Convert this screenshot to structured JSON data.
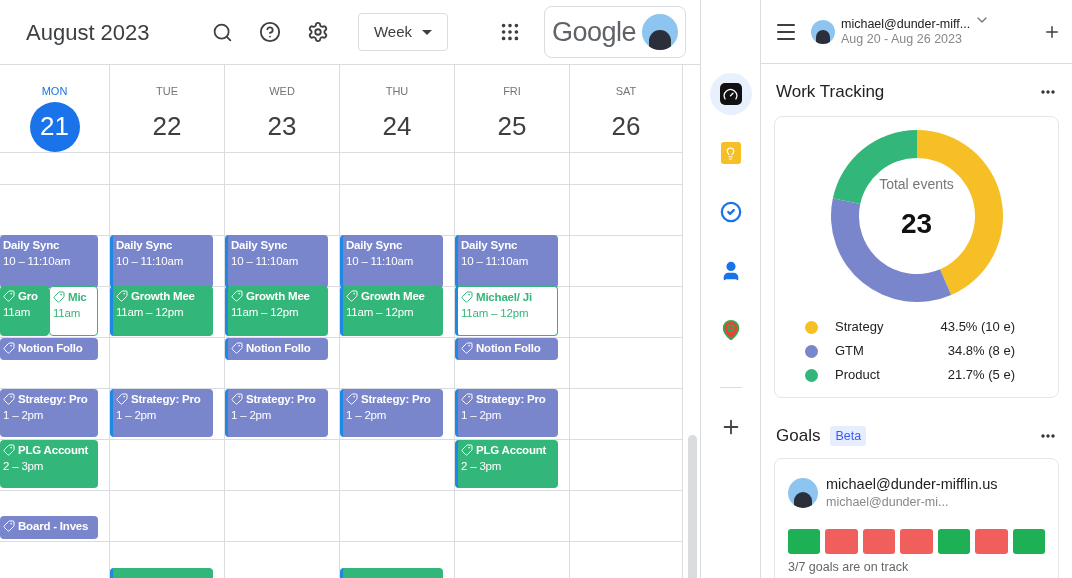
{
  "header": {
    "title": "August 2023",
    "view_select": "Week",
    "account_brand": "Google"
  },
  "days": [
    {
      "name": "MON",
      "number": "21",
      "selected": true,
      "events": [
        {
          "kind": "sync",
          "title": "Daily Sync",
          "time": "10 – 11:10am",
          "color": "#7986cb",
          "outlined": false
        },
        {
          "kind": "meeting",
          "title": "Gro",
          "time": "11am",
          "color": "#33b679",
          "outlined": false
        },
        {
          "kind": "meeting",
          "title": "Mic",
          "time": "11am",
          "color": "#33b679",
          "outlined": true
        },
        {
          "kind": "followup",
          "title": "Notion Follo",
          "color": "#7986cb",
          "outlined": false
        },
        {
          "kind": "strategy",
          "title": "Strategy: Pro",
          "time": "1 – 2pm",
          "color": "#7986cb",
          "outlined": false
        },
        {
          "kind": "plg",
          "title": "PLG Account",
          "time": "2 – 3pm",
          "color": "#33b679",
          "outlined": false
        },
        {
          "kind": "board",
          "title": "Board - Inves",
          "color": "#7986cb",
          "outlined": false
        }
      ]
    },
    {
      "name": "TUE",
      "number": "22",
      "selected": false,
      "events": [
        {
          "kind": "sync",
          "title": "Daily Sync",
          "time": "10 – 11:10am",
          "color": "#7986cb",
          "outlined": false
        },
        {
          "kind": "meeting",
          "title": "Growth Mee",
          "time": "11am – 12pm",
          "color": "#33b679",
          "outlined": false
        },
        {
          "kind": "strategy",
          "title": "Strategy: Pro",
          "time": "1 – 2pm",
          "color": "#7986cb",
          "outlined": false
        },
        {
          "kind": "internal",
          "color": "#33b679",
          "outlined": false
        }
      ]
    },
    {
      "name": "WED",
      "number": "23",
      "selected": false,
      "events": [
        {
          "kind": "sync",
          "title": "Daily Sync",
          "time": "10 – 11:10am",
          "color": "#7986cb",
          "outlined": false
        },
        {
          "kind": "meeting",
          "title": "Growth Mee",
          "time": "11am – 12pm",
          "color": "#33b679",
          "outlined": false
        },
        {
          "kind": "followup",
          "title": "Notion Follo",
          "color": "#7986cb",
          "outlined": false
        },
        {
          "kind": "strategy",
          "title": "Strategy: Pro",
          "time": "1 – 2pm",
          "color": "#7986cb",
          "outlined": false
        }
      ]
    },
    {
      "name": "THU",
      "number": "24",
      "selected": false,
      "events": [
        {
          "kind": "sync",
          "title": "Daily Sync",
          "time": "10 – 11:10am",
          "color": "#7986cb",
          "outlined": false
        },
        {
          "kind": "meeting",
          "title": "Growth Mee",
          "time": "11am – 12pm",
          "color": "#33b679",
          "outlined": false
        },
        {
          "kind": "strategy",
          "title": "Strategy: Pro",
          "time": "1 – 2pm",
          "color": "#7986cb",
          "outlined": false
        },
        {
          "kind": "internal",
          "color": "#33b679",
          "outlined": false
        }
      ]
    },
    {
      "name": "FRI",
      "number": "25",
      "selected": false,
      "events": [
        {
          "kind": "sync",
          "title": "Daily Sync",
          "time": "10 – 11:10am",
          "color": "#7986cb",
          "outlined": false
        },
        {
          "kind": "meeting",
          "title": "Michael/ Ji",
          "time": "11am – 12pm",
          "color": "#33b679",
          "outlined": true
        },
        {
          "kind": "followup",
          "title": "Notion Follo",
          "color": "#7986cb",
          "outlined": false
        },
        {
          "kind": "strategy",
          "title": "Strategy: Pro",
          "time": "1 – 2pm",
          "color": "#7986cb",
          "outlined": false
        },
        {
          "kind": "plg",
          "title": "PLG Account",
          "time": "2 – 3pm",
          "color": "#33b679",
          "outlined": false
        }
      ]
    },
    {
      "name": "SAT",
      "number": "26",
      "selected": false
    }
  ],
  "rail": [
    {
      "kind": "gauge",
      "selected": true
    },
    {
      "kind": "keep",
      "selected": false
    },
    {
      "kind": "tasks",
      "selected": false
    },
    {
      "kind": "contacts",
      "selected": false
    },
    {
      "kind": "maps",
      "selected": false
    },
    {
      "kind": "add",
      "selected": false
    }
  ],
  "panel": {
    "account": "michael@dunder-miff...",
    "date_range": "Aug 20 - Aug 26 2023",
    "work_tracking": {
      "title": "Work Tracking",
      "center_label": "Total events",
      "total": "23",
      "chart_data": {
        "type": "donut",
        "categories": [
          "Strategy",
          "GTM",
          "Product"
        ],
        "values": [
          43.5,
          34.8,
          21.7
        ]
      },
      "legend": [
        {
          "value": "43.5% (10 e)",
          "color": "#f6bf26"
        },
        {
          "value": "34.8% (8 e)",
          "color": "#7986cb"
        },
        {
          "value": "21.7% (5 e)",
          "color": "#33b679"
        }
      ]
    },
    "goals": {
      "title": "Goals",
      "badge": "Beta",
      "name": "michael@dunder-mifflin.us",
      "email": "michael@dunder-mi...",
      "bars": [
        {
          "on_track": true
        },
        {
          "on_track": false
        },
        {
          "on_track": false
        },
        {
          "on_track": false
        },
        {
          "on_track": true
        },
        {
          "on_track": false
        },
        {
          "on_track": true
        }
      ],
      "summary": "3/7 goals are on track"
    }
  }
}
